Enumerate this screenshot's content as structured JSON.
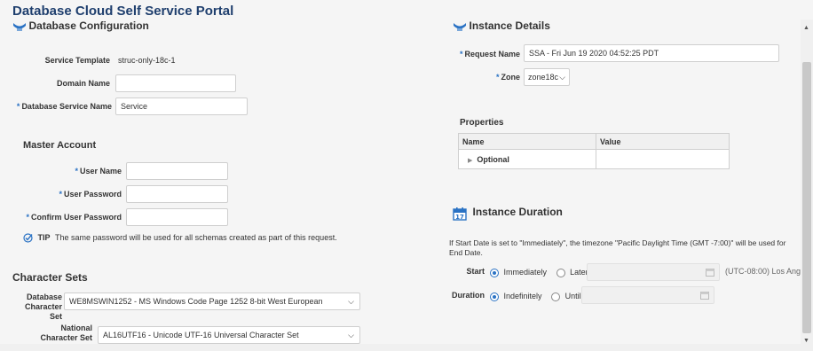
{
  "portal_title": "Database Cloud Self Service Portal",
  "db_config": {
    "title": "Database Configuration",
    "service_template_label": "Service Template",
    "service_template_value": "struc-only-18c-1",
    "domain_name_label": "Domain Name",
    "domain_name_value": "",
    "db_service_name_label": "Database Service Name",
    "db_service_name_value": "Service"
  },
  "master_account": {
    "title": "Master Account",
    "user_name_label": "User Name",
    "user_password_label": "User Password",
    "confirm_password_label": "Confirm User Password",
    "tip_label": "TIP",
    "tip_text": "The same password will be used for all schemas created as part of this request."
  },
  "charsets": {
    "title": "Character Sets",
    "db_charset_label": "Database Character Set",
    "db_charset_value": "WE8MSWIN1252 - MS Windows Code Page 1252 8-bit West European",
    "national_charset_label": "National Character Set",
    "national_charset_value": "AL16UTF16 - Unicode UTF-16 Universal Character Set"
  },
  "instance_details": {
    "title": "Instance Details",
    "request_name_label": "Request Name",
    "request_name_value": "SSA - Fri Jun 19 2020 04:52:25 PDT",
    "zone_label": "Zone",
    "zone_value": "zone18c"
  },
  "properties": {
    "title": "Properties",
    "columns": [
      "Name",
      "Value"
    ],
    "rows": [
      {
        "name": "Optional",
        "value": ""
      }
    ]
  },
  "instance_duration": {
    "title": "Instance Duration",
    "calendar_day": "17",
    "note": "If Start Date is set to \"Immediately\", the timezone \"Pacific Daylight Time (GMT -7:00)\" will be used for End Date.",
    "start_label": "Start",
    "start_opt1": "Immediately",
    "start_opt2": "Later",
    "timezone_text": "(UTC-08:00) Los Ange",
    "duration_label": "Duration",
    "duration_opt1": "Indefinitely",
    "duration_opt2": "Until"
  },
  "colors": {
    "accent": "#2a72c4",
    "title": "#1f3f6e"
  }
}
